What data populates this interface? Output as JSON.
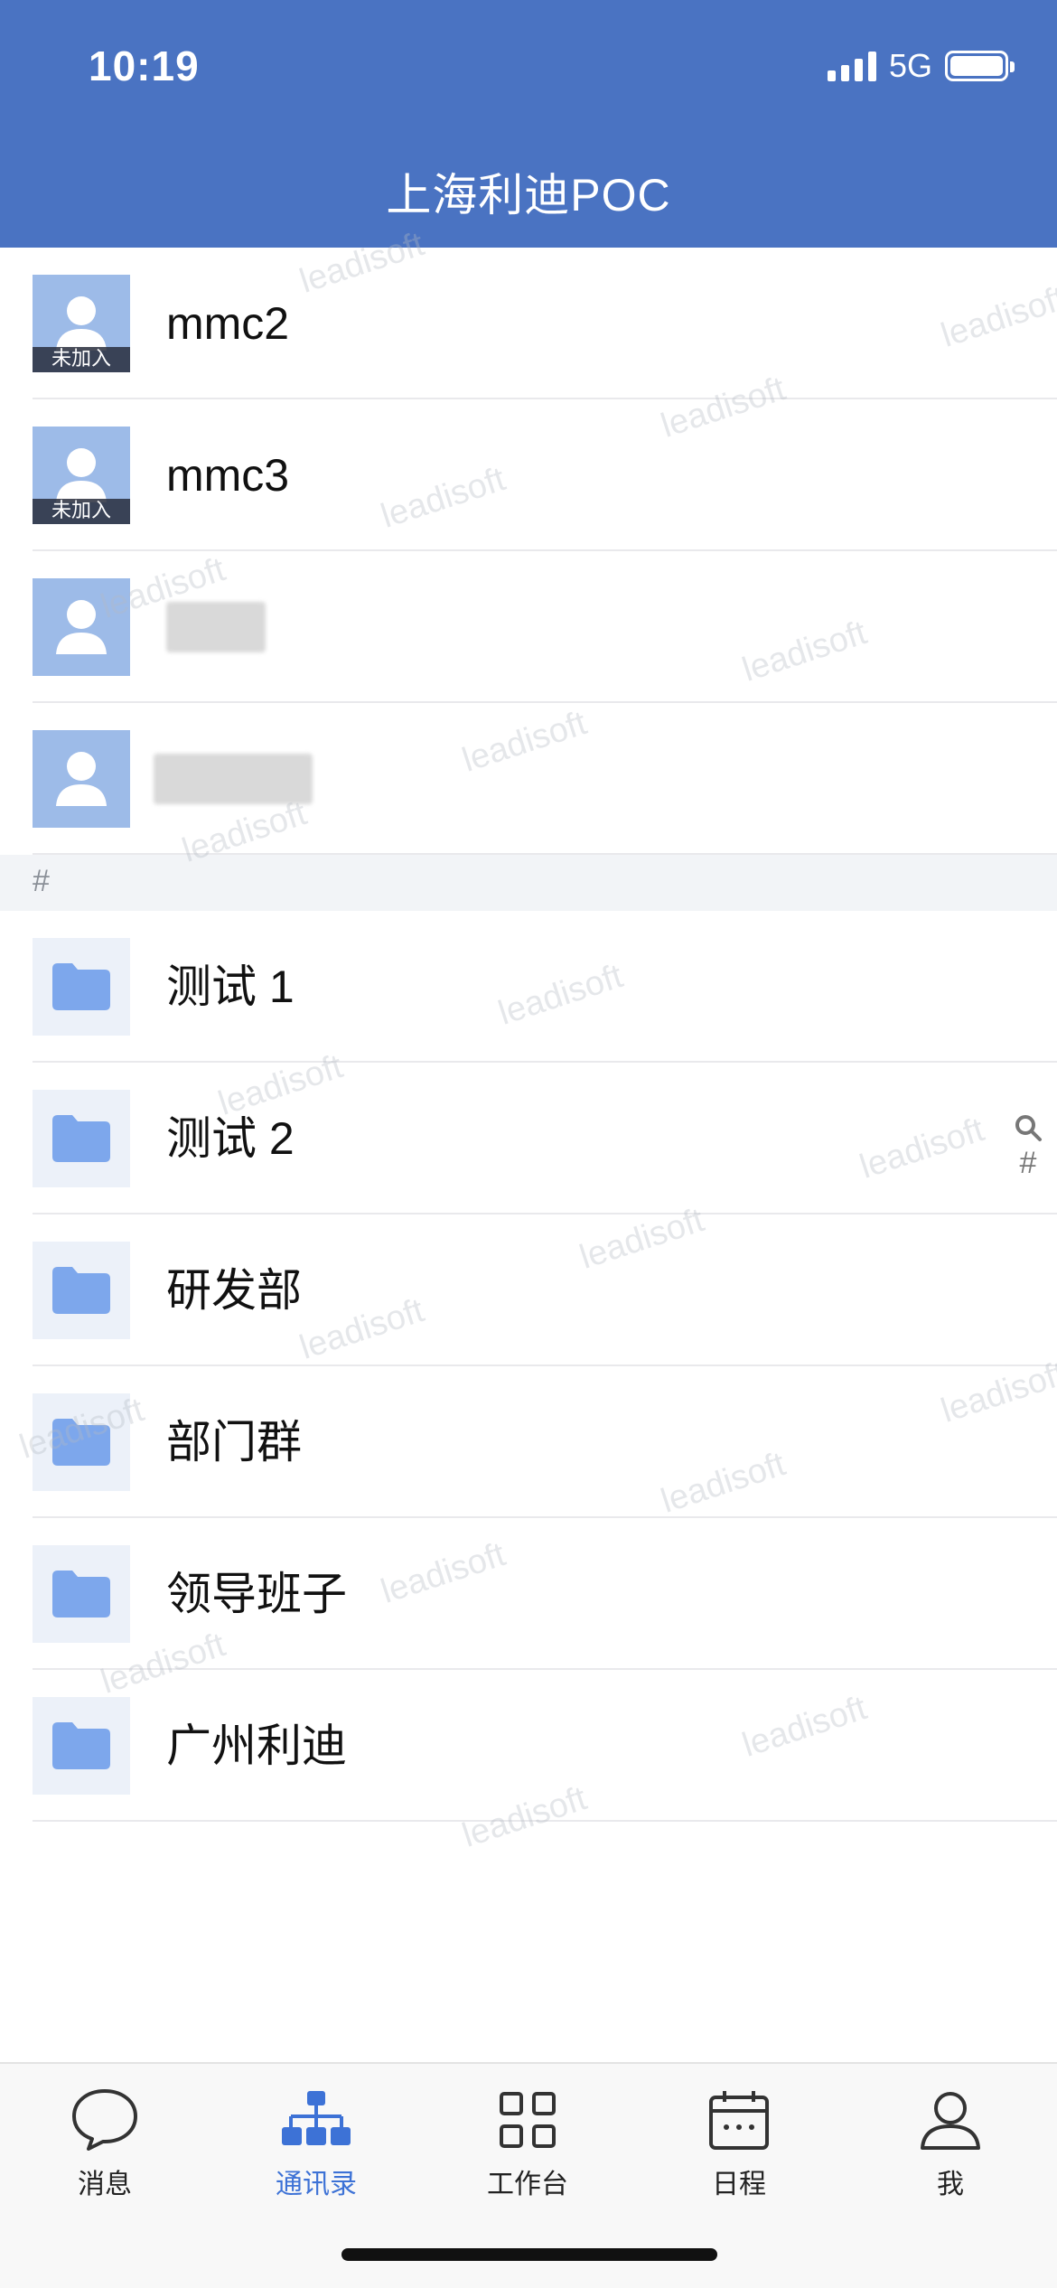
{
  "status_bar": {
    "time": "10:19",
    "network": "5G"
  },
  "header": {
    "title": "上海利迪POC"
  },
  "contacts": [
    {
      "name": "mmc2",
      "badge": "未加入"
    },
    {
      "name": "mmc3",
      "badge": "未加入"
    }
  ],
  "section": {
    "label": "#"
  },
  "groups": [
    {
      "name": "测试 1"
    },
    {
      "name": "测试 2"
    },
    {
      "name": "研发部"
    },
    {
      "name": "部门群"
    },
    {
      "name": "领导班子"
    },
    {
      "name": "广州利迪"
    }
  ],
  "side_index": {
    "hash": "#"
  },
  "watermark": "leadisoft",
  "tabbar": {
    "messages": "消息",
    "contacts": "通讯录",
    "workbench": "工作台",
    "schedule": "日程",
    "me": "我"
  },
  "colors": {
    "header": "#4a73c2",
    "accent": "#3d72d6",
    "folder": "#7da7ec"
  }
}
